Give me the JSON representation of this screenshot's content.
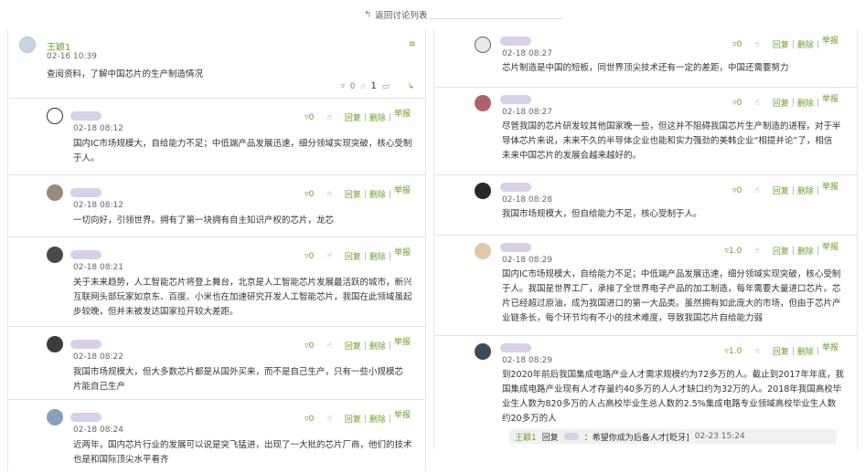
{
  "nav": {
    "back_label": "返回讨论列表"
  },
  "post": {
    "author": "王颖1",
    "date": "02-16 10:39",
    "text": "查阅资料，了解中国芯片的生产制造情况",
    "stats": {
      "dislikes": "0",
      "likes": "1"
    },
    "icons": {
      "menu": "list-menu-icon",
      "dislike": "thumb-down-icon",
      "like": "thumb-up-icon",
      "comment": "comment-icon",
      "expand": "expand-icon"
    }
  },
  "actions": {
    "reply": "回复",
    "delete": "删除",
    "report": "举报"
  },
  "left_replies": [
    {
      "date": "02-18 08:12",
      "likes": "0",
      "text": [
        "国内IC市场规模大，自给能力不足；中低端产品发展迅速，细分领域实现突破，核心受制",
        "于人。"
      ],
      "avatar_color": "#ffffff"
    },
    {
      "date": "02-18 08:12",
      "likes": "0",
      "text": [
        "一切向好，引领世界。拥有了第一块拥有自主知识产权的芯片，龙芯"
      ],
      "avatar_color": "#9c8a78"
    },
    {
      "date": "02-18 08:21",
      "likes": "0",
      "text": [
        "关于未来趋势，人工智能芯片将登上舞台，北京是人工智能芯片发展最活跃的城市，新兴",
        "互联网头部玩家如京东、百度、小米也在加速研究开发人工智能芯片，我国在此领域虽起",
        "步较晚，但并未被发达国家拉开较大差距。"
      ],
      "avatar_color": "#4a4a4a"
    },
    {
      "date": "02-18 08:22",
      "likes": "0",
      "text": [
        "我国市场规模大，但大多数芯片都是从国外买来，而不是自己生产，只有一些小规模芯",
        "片能自己生产"
      ],
      "avatar_color": "#3c3c3c"
    },
    {
      "date": "02-18 08:24",
      "likes": "0",
      "text": [
        "近两年，国内芯片行业的发展可以说是突飞猛进，出现了一大批的芯片厂商，他们的技术",
        "也是和国际顶尖水平看齐"
      ],
      "avatar_color": "#8aa0b8"
    }
  ],
  "right_replies": [
    {
      "date": "02-18 08:27",
      "likes": "0",
      "text": [
        "芯片制造是中国的短板，同世界顶尖技术还有一定的差距，中国还需要努力"
      ],
      "avatar_color": "#e8e8e8"
    },
    {
      "date": "02-18 08:27",
      "likes": "0",
      "text": [
        "尽管我国的芯片研发较其他国家晚一些，但这并不阻碍我国芯片生产制造的进程，对于半",
        "导体芯片来说，未来不久的半导体企业也能和实力强劲的美韩企业“相提并论”了，相信",
        "未来中国芯片的发展会越来越好的。"
      ],
      "avatar_color": "#b0606a"
    },
    {
      "date": "02-18 08:28",
      "likes": "0",
      "text": [
        "我国市场规模大，但自给能力不足，核心受制于人。"
      ],
      "avatar_color": "#2a2a2a"
    },
    {
      "date": "02-18 08:29",
      "likes": "1.0",
      "text": [
        "国内IC市场规模大，自给能力不足；中低端产品发展迅速，细分领域实现突破，核心受制",
        "于人。我国是世界工厂，承接了全世界电子产品的加工制造，每年需要大量进口芯片。芯",
        "片已经超过原油，成为我国进口的第一大品类。虽然拥有如此庞大的市场，但由于芯片产",
        "业链条长，每个环节均有不小的技术难度，导致我国芯片自给能力弱"
      ],
      "avatar_color": "#e0c8a8"
    },
    {
      "date": "02-18 08:29",
      "likes": "1.0",
      "text": [
        "到2020年前后我国集成电路产业人才需求规模约为72多万的人。截止到2017年年底，我",
        "国集成电路产业现有人才存量约40多万的人人才缺口约为32万的人。2018年我国高校毕",
        "业生人数为820多万的人占高校毕业生总人数的2.5%集成电路专业领域高校毕业生人数",
        "约20多万的人"
      ],
      "avatar_color": "#3a4a5a",
      "subreply": {
        "user": "王颖1",
        "verb": "回复",
        "text": "：希望你成为后备人才[眨牙]",
        "time": "02-23 15:24"
      }
    }
  ]
}
